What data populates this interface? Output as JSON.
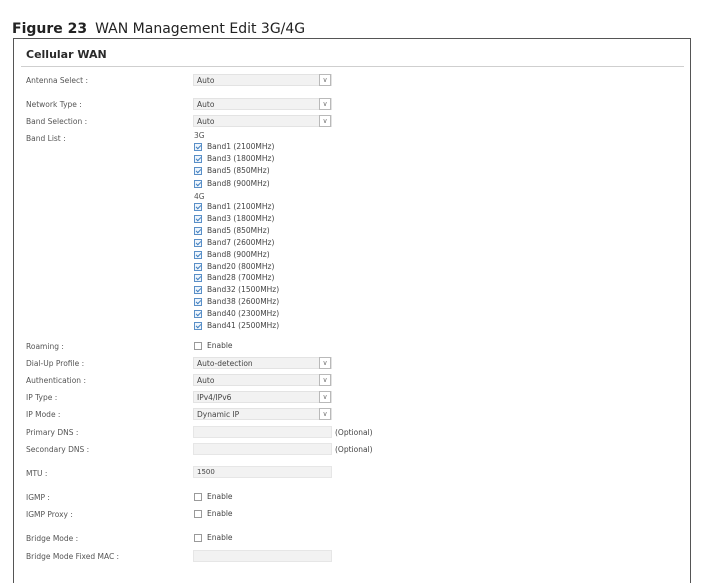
{
  "figure": {
    "number": "Figure 23",
    "title": "WAN Management Edit 3G/4G"
  },
  "section": {
    "title": "Cellular WAN"
  },
  "fields": {
    "antenna_select": {
      "label": "Antenna Select :",
      "value": "Auto"
    },
    "network_type": {
      "label": "Network Type :",
      "value": "Auto"
    },
    "band_selection": {
      "label": "Band Selection :",
      "value": "Auto"
    },
    "band_list": {
      "label": "Band List :"
    },
    "roaming": {
      "label": "Roaming :",
      "option": "Enable",
      "checked": false
    },
    "dialup_profile": {
      "label": "Dial-Up Profile :",
      "value": "Auto-detection"
    },
    "authentication": {
      "label": "Authentication :",
      "value": "Auto"
    },
    "ip_type": {
      "label": "IP Type :",
      "value": "IPv4/IPv6"
    },
    "ip_mode": {
      "label": "IP Mode :",
      "value": "Dynamic IP"
    },
    "primary_dns": {
      "label": "Primary DNS :",
      "value": "",
      "note": "(Optional)"
    },
    "secondary_dns": {
      "label": "Secondary DNS :",
      "value": "",
      "note": "(Optional)"
    },
    "mtu": {
      "label": "MTU :",
      "value": "1500"
    },
    "igmp": {
      "label": "IGMP :",
      "option": "Enable",
      "checked": false
    },
    "igmp_proxy": {
      "label": "IGMP Proxy :",
      "option": "Enable",
      "checked": false
    },
    "bridge_mode": {
      "label": "Bridge Mode :",
      "option": "Enable",
      "checked": false
    },
    "bridge_mac": {
      "label": "Bridge Mode Fixed MAC :",
      "value": ""
    }
  },
  "bands": {
    "g3": {
      "label": "3G",
      "items": [
        {
          "label": "Band1 (2100MHz)",
          "checked": true
        },
        {
          "label": "Band3 (1800MHz)",
          "checked": true
        },
        {
          "label": "Band5 (850MHz)",
          "checked": true
        },
        {
          "label": "Band8 (900MHz)",
          "checked": true
        }
      ]
    },
    "g4": {
      "label": "4G",
      "items": [
        {
          "label": "Band1 (2100MHz)",
          "checked": true
        },
        {
          "label": "Band3 (1800MHz)",
          "checked": true
        },
        {
          "label": "Band5 (850MHz)",
          "checked": true
        },
        {
          "label": "Band7 (2600MHz)",
          "checked": true
        },
        {
          "label": "Band8 (900MHz)",
          "checked": true
        },
        {
          "label": "Band20 (800MHz)",
          "checked": true
        },
        {
          "label": "Band28 (700MHz)",
          "checked": true
        },
        {
          "label": "Band32 (1500MHz)",
          "checked": true
        },
        {
          "label": "Band38 (2600MHz)",
          "checked": true
        },
        {
          "label": "Band40 (2300MHz)",
          "checked": true
        },
        {
          "label": "Band41 (2500MHz)",
          "checked": true
        }
      ]
    }
  }
}
